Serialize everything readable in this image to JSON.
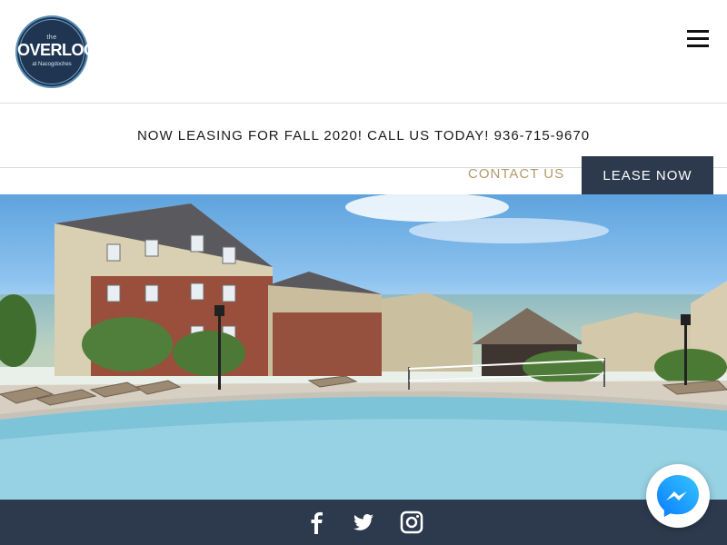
{
  "header": {
    "logo": {
      "the": "the",
      "name": "OVERLOOK",
      "place": "at Nacogdoches"
    },
    "menu_icon": "hamburger-menu-icon"
  },
  "announcement": {
    "text": "NOW LEASING FOR FALL 2020! CALL US TODAY! 936-715-9670"
  },
  "nav": {
    "contact_label": "CONTACT US",
    "lease_label": "LEASE NOW"
  },
  "hero": {
    "image": "apartment-pool-photo"
  },
  "footer": {
    "social": [
      {
        "name": "facebook-icon"
      },
      {
        "name": "twitter-icon"
      },
      {
        "name": "instagram-icon"
      }
    ]
  },
  "chat": {
    "icon": "messenger-icon"
  },
  "colors": {
    "navy": "#2d3a4e",
    "gold": "#b3996a",
    "logo_blue": "#1f3552"
  }
}
